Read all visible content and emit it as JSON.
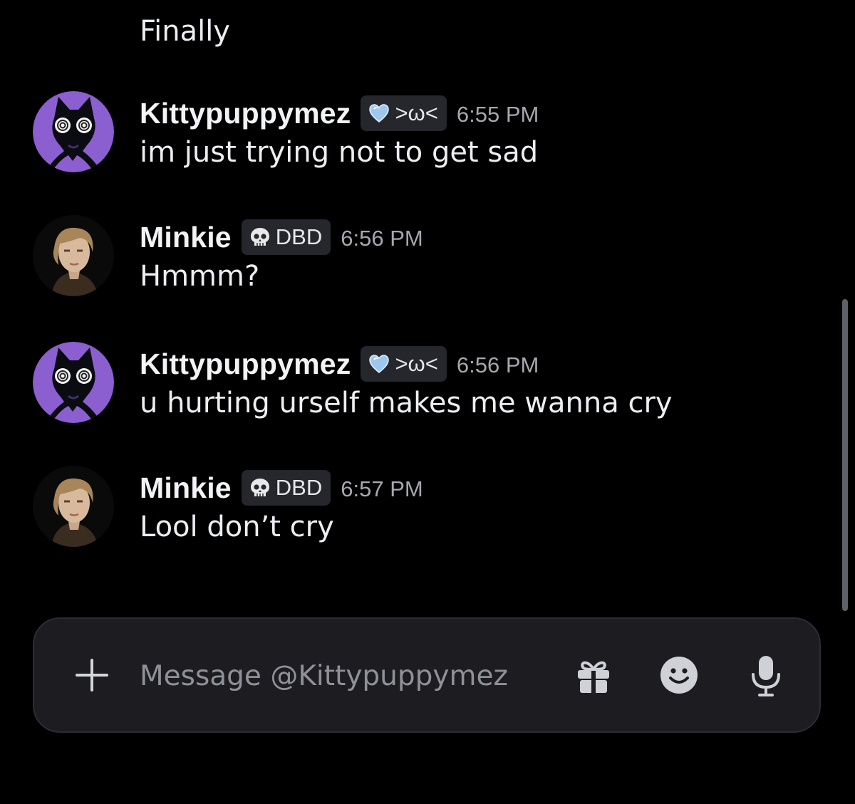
{
  "chat": {
    "continued_message": "Finally",
    "messages": [
      {
        "username": "Kittypuppymez",
        "tag": ">ω<",
        "tag_icon": "heart-icon",
        "time": "6:55 PM",
        "text": "im just trying not to get sad",
        "avatar": "cat-avatar"
      },
      {
        "username": "Minkie",
        "tag": "DBD",
        "tag_icon": "skull-icon",
        "time": "6:56 PM",
        "text": "Hmmm?",
        "avatar": "portrait-avatar"
      },
      {
        "username": "Kittypuppymez",
        "tag": ">ω<",
        "tag_icon": "heart-icon",
        "time": "6:56 PM",
        "text": "u hurting urself makes me wanna cry",
        "avatar": "cat-avatar"
      },
      {
        "username": "Minkie",
        "tag": "DBD",
        "tag_icon": "skull-icon",
        "time": "6:57 PM",
        "text": "Lool don’t cry",
        "avatar": "portrait-avatar"
      }
    ]
  },
  "composer": {
    "placeholder": "Message @Kittypuppymez",
    "value": "",
    "icons": [
      "plus-icon",
      "gift-icon",
      "emoji-icon",
      "microphone-icon"
    ]
  },
  "colors": {
    "background": "#000000",
    "composer_bg": "#1c1c21",
    "tag_bg": "#26272d",
    "cat_avatar_purple": "#8c5fd0",
    "timestamp": "#a6a8ae"
  }
}
